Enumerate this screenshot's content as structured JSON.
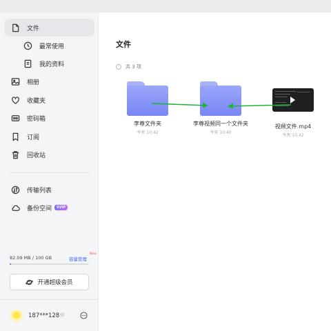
{
  "sidebar": {
    "items": [
      {
        "label": "文件"
      },
      {
        "label": "最常使用"
      },
      {
        "label": "我的资料"
      },
      {
        "label": "相册"
      },
      {
        "label": "收藏夹"
      },
      {
        "label": "密码箱"
      },
      {
        "label": "订阅"
      },
      {
        "label": "回收站"
      },
      {
        "label": "传输列表"
      },
      {
        "label": "备份空间",
        "badge": "SVIP"
      }
    ],
    "storage": {
      "text": "82.09 MB / 100 GB",
      "manage_label": "容量管理",
      "new_badge": "New",
      "used_fraction": 0.0008
    },
    "vip_button": "开通超级会员",
    "user": {
      "name": "187***128",
      "indicator": "◎"
    }
  },
  "main": {
    "title": "文件",
    "count_label": "共 3 项",
    "files": [
      {
        "name": "李尊文件夹",
        "time": "今天 10:42",
        "type": "folder"
      },
      {
        "name": "李尊视频同一个文件夹",
        "time": "今天 10:40",
        "type": "folder"
      },
      {
        "name": "视频文件.mp4",
        "time": "今天 10:42",
        "type": "video"
      }
    ]
  },
  "colors": {
    "accent": "#4a6cf7",
    "folder": "#8792f6",
    "arrow": "#1db33a"
  }
}
